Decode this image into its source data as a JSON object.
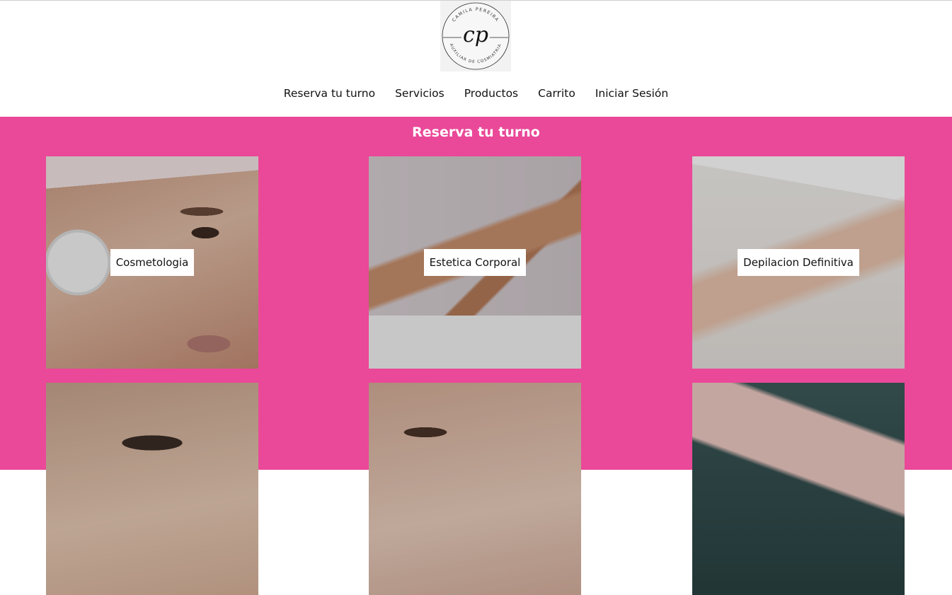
{
  "brand": {
    "logo_name": "CAMILA PEREIRA",
    "logo_monogram": "cp",
    "logo_subtitle": "AUXILIAR DE COSMIATRIA"
  },
  "nav": {
    "items": [
      {
        "label": "Reserva tu turno"
      },
      {
        "label": "Servicios"
      },
      {
        "label": "Productos"
      },
      {
        "label": "Carrito"
      },
      {
        "label": "Iniciar Sesión"
      }
    ]
  },
  "main": {
    "title": "Reserva tu turno",
    "background": "#ea4898",
    "cards": [
      {
        "label": "Cosmetologia"
      },
      {
        "label": "Estetica Corporal"
      },
      {
        "label": "Depilacion Definitiva"
      }
    ]
  }
}
